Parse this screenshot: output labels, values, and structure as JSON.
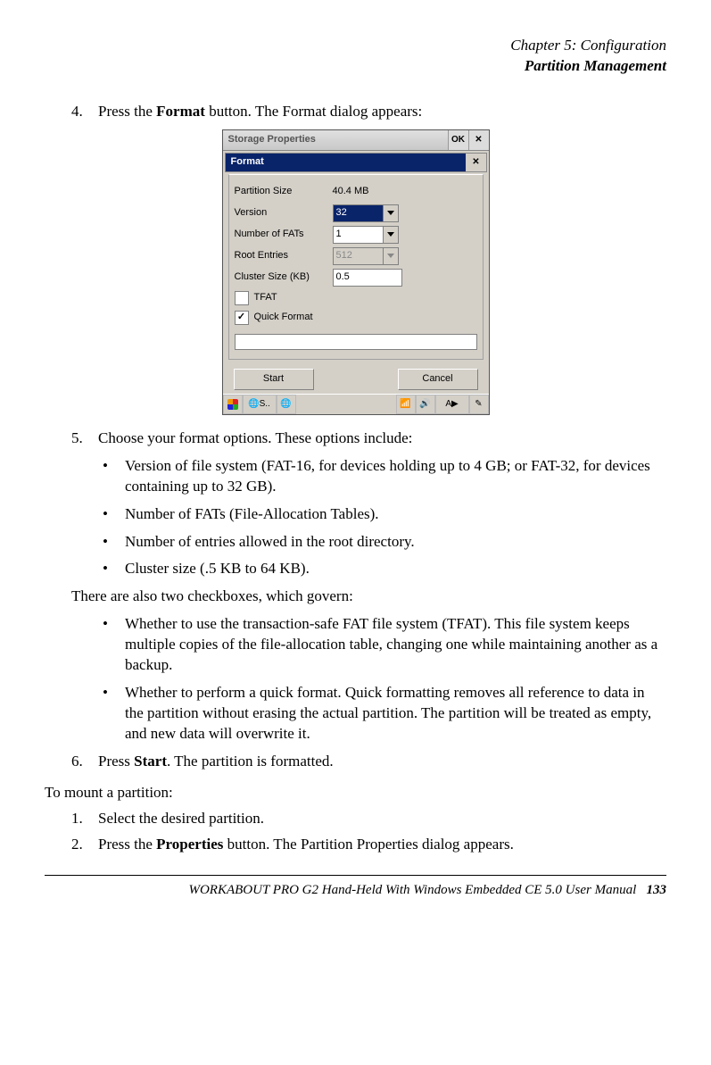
{
  "header": {
    "line1": "Chapter 5: Configuration",
    "line2": "Partition Management"
  },
  "steps": {
    "s4_num": "4.",
    "s4_a": "Press the ",
    "s4_b": "Format",
    "s4_c": " button. The Format dialog appears:",
    "s5_num": "5.",
    "s5_txt": "Choose your format options. These options include:",
    "s6_num": "6.",
    "s6_a": "Press ",
    "s6_b": "Start",
    "s6_c": ". The partition is formatted."
  },
  "bullets1": {
    "b1": "Version of file system (FAT-16, for devices holding up to 4 GB; or FAT-32, for devices containing up to 32 GB).",
    "b2": "Number of FATs (File-Allocation Tables).",
    "b3": "Number of entries allowed in the root directory.",
    "b4": "Cluster size (.5 KB to 64 KB)."
  },
  "mid_text": "There are also two checkboxes, which govern:",
  "bullets2": {
    "b1": "Whether to use the transaction-safe FAT file system (TFAT). This file system keeps multiple copies of the file-allocation table, changing one while maintaining another as a backup.",
    "b2": "Whether to perform a quick format. Quick formatting removes all reference to data in the partition without erasing the actual partition. The partition will be treated as empty, and new data will overwrite it."
  },
  "mount_intro": "To mount a partition:",
  "mount": {
    "m1_num": "1.",
    "m1_txt": "Select the desired partition.",
    "m2_num": "2.",
    "m2_a": "Press the ",
    "m2_b": "Properties",
    "m2_c": " button. The Partition Properties dialog appears."
  },
  "footer": {
    "title": "WORKABOUT PRO G2 Hand-Held With Windows Embedded CE 5.0 User Manual",
    "page": "133"
  },
  "dialog": {
    "outer_title": "Storage Properties",
    "ok_label": "OK",
    "close_glyph": "✕",
    "inner_title": "Format",
    "labels": {
      "partition_size": "Partition Size",
      "version": "Version",
      "num_fats": "Number of FATs",
      "root_entries": "Root Entries",
      "cluster_size": "Cluster Size (KB)",
      "tfat": "TFAT",
      "quick_format": "Quick Format"
    },
    "values": {
      "partition_size": "40.4 MB",
      "version": "32",
      "num_fats": "1",
      "root_entries": "512",
      "cluster_size": "0.5"
    },
    "checkboxes": {
      "tfat_checked": false,
      "quick_format_checked": true
    },
    "buttons": {
      "start": "Start",
      "cancel": "Cancel"
    },
    "taskbar": {
      "conn_label": "S..",
      "kbd_label": "A"
    }
  },
  "bullet_glyph": "•"
}
